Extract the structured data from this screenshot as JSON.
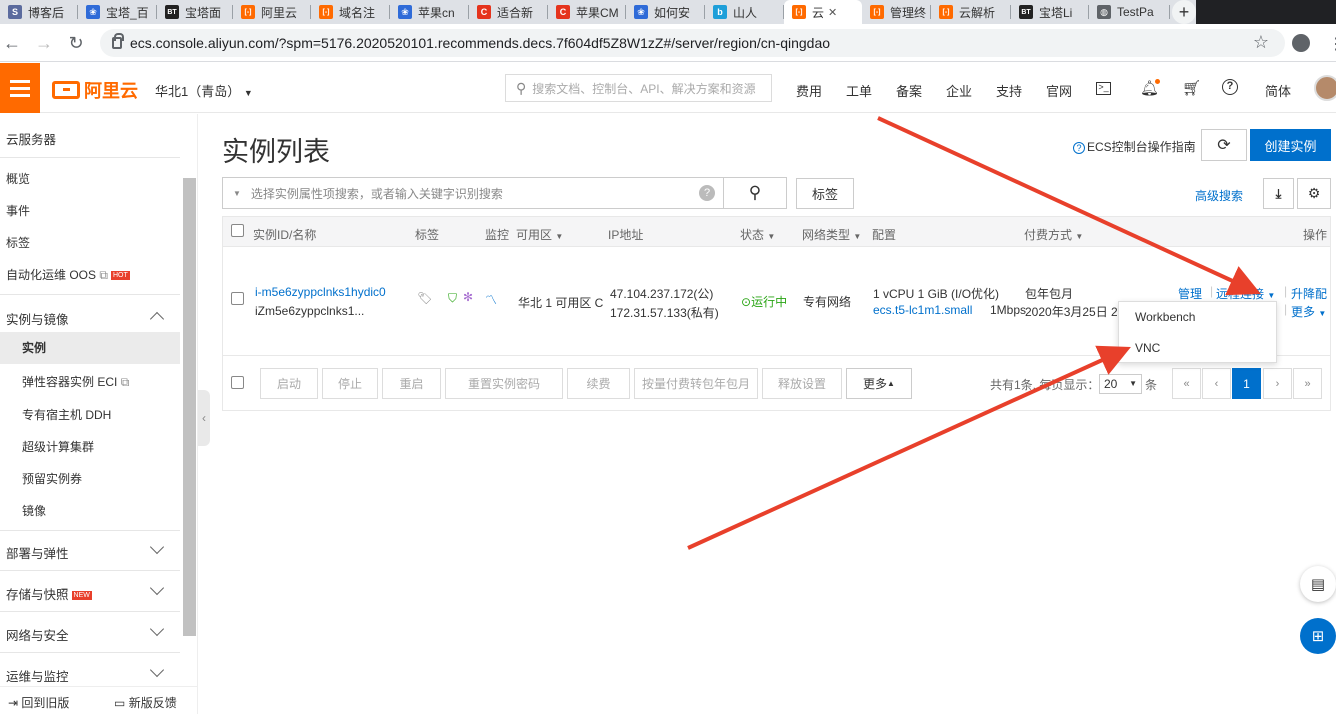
{
  "browser": {
    "tabs": [
      {
        "label": "博客后",
        "fav": "sogou-icon",
        "color": "#5b6b9e",
        "glyph": "S"
      },
      {
        "label": "宝塔_百",
        "fav": "baidu-paw-icon",
        "color": "#2f6bd8",
        "glyph": "❀"
      },
      {
        "label": "宝塔面",
        "fav": "bt-icon",
        "color": "#222222",
        "glyph": "BT"
      },
      {
        "label": "阿里云",
        "fav": "aliyun-icon",
        "color": "#ff6a00",
        "glyph": "[-]"
      },
      {
        "label": "域名注",
        "fav": "aliyun-icon",
        "color": "#ff6a00",
        "glyph": "[-]"
      },
      {
        "label": "苹果cn",
        "fav": "baidu-paw-icon",
        "color": "#2f6bd8",
        "glyph": "❀"
      },
      {
        "label": "适合新",
        "fav": "csdn-icon",
        "color": "#e5341d",
        "glyph": "C"
      },
      {
        "label": "苹果CM",
        "fav": "csdn-icon",
        "color": "#e5341d",
        "glyph": "C"
      },
      {
        "label": "如何安",
        "fav": "baidu-paw-icon",
        "color": "#2f6bd8",
        "glyph": "❀"
      },
      {
        "label": "山人",
        "fav": "bilibili-icon",
        "color": "#1e9fd9",
        "glyph": "b"
      },
      {
        "label": "云",
        "fav": "aliyun-icon",
        "color": "#ff6a00",
        "glyph": "[-]"
      },
      {
        "label": "管理终",
        "fav": "aliyun-icon",
        "color": "#ff6a00",
        "glyph": "[-]"
      },
      {
        "label": "云解析",
        "fav": "aliyun-icon",
        "color": "#ff6a00",
        "glyph": "[-]"
      },
      {
        "label": "宝塔Li",
        "fav": "bt-icon",
        "color": "#222222",
        "glyph": "BT"
      },
      {
        "label": "TestPa",
        "fav": "globe-icon",
        "color": "#5f6368",
        "glyph": "◍"
      }
    ],
    "url": "ecs.console.aliyun.com/?spm=5176.2020520101.recommends.decs.7f604df5Z8W1zZ#/server/region/cn-qingdao"
  },
  "header": {
    "logo": "阿里云",
    "region": "华北1（青岛）",
    "search_placeholder": "搜索文档、控制台、API、解决方案和资源",
    "nav": [
      "费用",
      "工单",
      "备案",
      "企业",
      "支持",
      "官网"
    ],
    "lang": "简体"
  },
  "sidebar": {
    "title": "云服务器",
    "items": [
      "概览",
      "事件",
      "标签",
      "自动化运维 OOS"
    ],
    "hot": "HOT",
    "group1": "实例与镜像",
    "group1_items": [
      "实例",
      "弹性容器实例 ECI",
      "专有宿主机 DDH",
      "超级计算集群",
      "预留实例券",
      "镜像"
    ],
    "groups": [
      "部署与弹性",
      "存储与快照",
      "网络与安全",
      "运维与监控"
    ],
    "new": "NEW",
    "bottom_left": "回到旧版",
    "bottom_right": "新版反馈"
  },
  "main": {
    "title": "实例列表",
    "guide": "ECS控制台操作指南",
    "create": "创建实例",
    "filter_placeholder": "选择实例属性项搜索，或者输入关键字识别搜索",
    "tag_btn": "标签",
    "advanced": "高级搜索",
    "columns": [
      "实例ID/名称",
      "标签",
      "监控",
      "可用区",
      "IP地址",
      "状态",
      "网络类型",
      "配置",
      "付费方式",
      "操作"
    ],
    "row": {
      "id": "i-m5e6zyppclnks1hydic0",
      "name": "iZm5e6zyppclnks1...",
      "zone": "华北 1 可用区 C",
      "ip_public": "47.104.237.172(公)",
      "ip_private": "172.31.57.133(私有)",
      "status": "运行中",
      "network": "专有网络",
      "config1": "1 vCPU 1 GiB (I/O优化)",
      "config2": "ecs.t5-lc1m1.small",
      "bandwidth": "1Mbps",
      "pay1": "包年包月",
      "pay2": "2020年3月25日 23",
      "op_manage": "管理",
      "op_remote": "远程连接",
      "op_upgrade": "升降配",
      "op_more": "更多"
    },
    "footer_buttons": [
      "启动",
      "停止",
      "重启",
      "重置实例密码",
      "续费",
      "按量付费转包年包月",
      "释放设置",
      "更多"
    ],
    "pagination": {
      "total": "共有1条, 每页显示：",
      "size": "20",
      "unit": "条",
      "page": "1"
    },
    "dropdown": [
      "Workbench",
      "VNC"
    ]
  },
  "colors": {
    "accent": "#0070cc",
    "brand": "#ff6a00",
    "arrow": "#e8402b"
  }
}
